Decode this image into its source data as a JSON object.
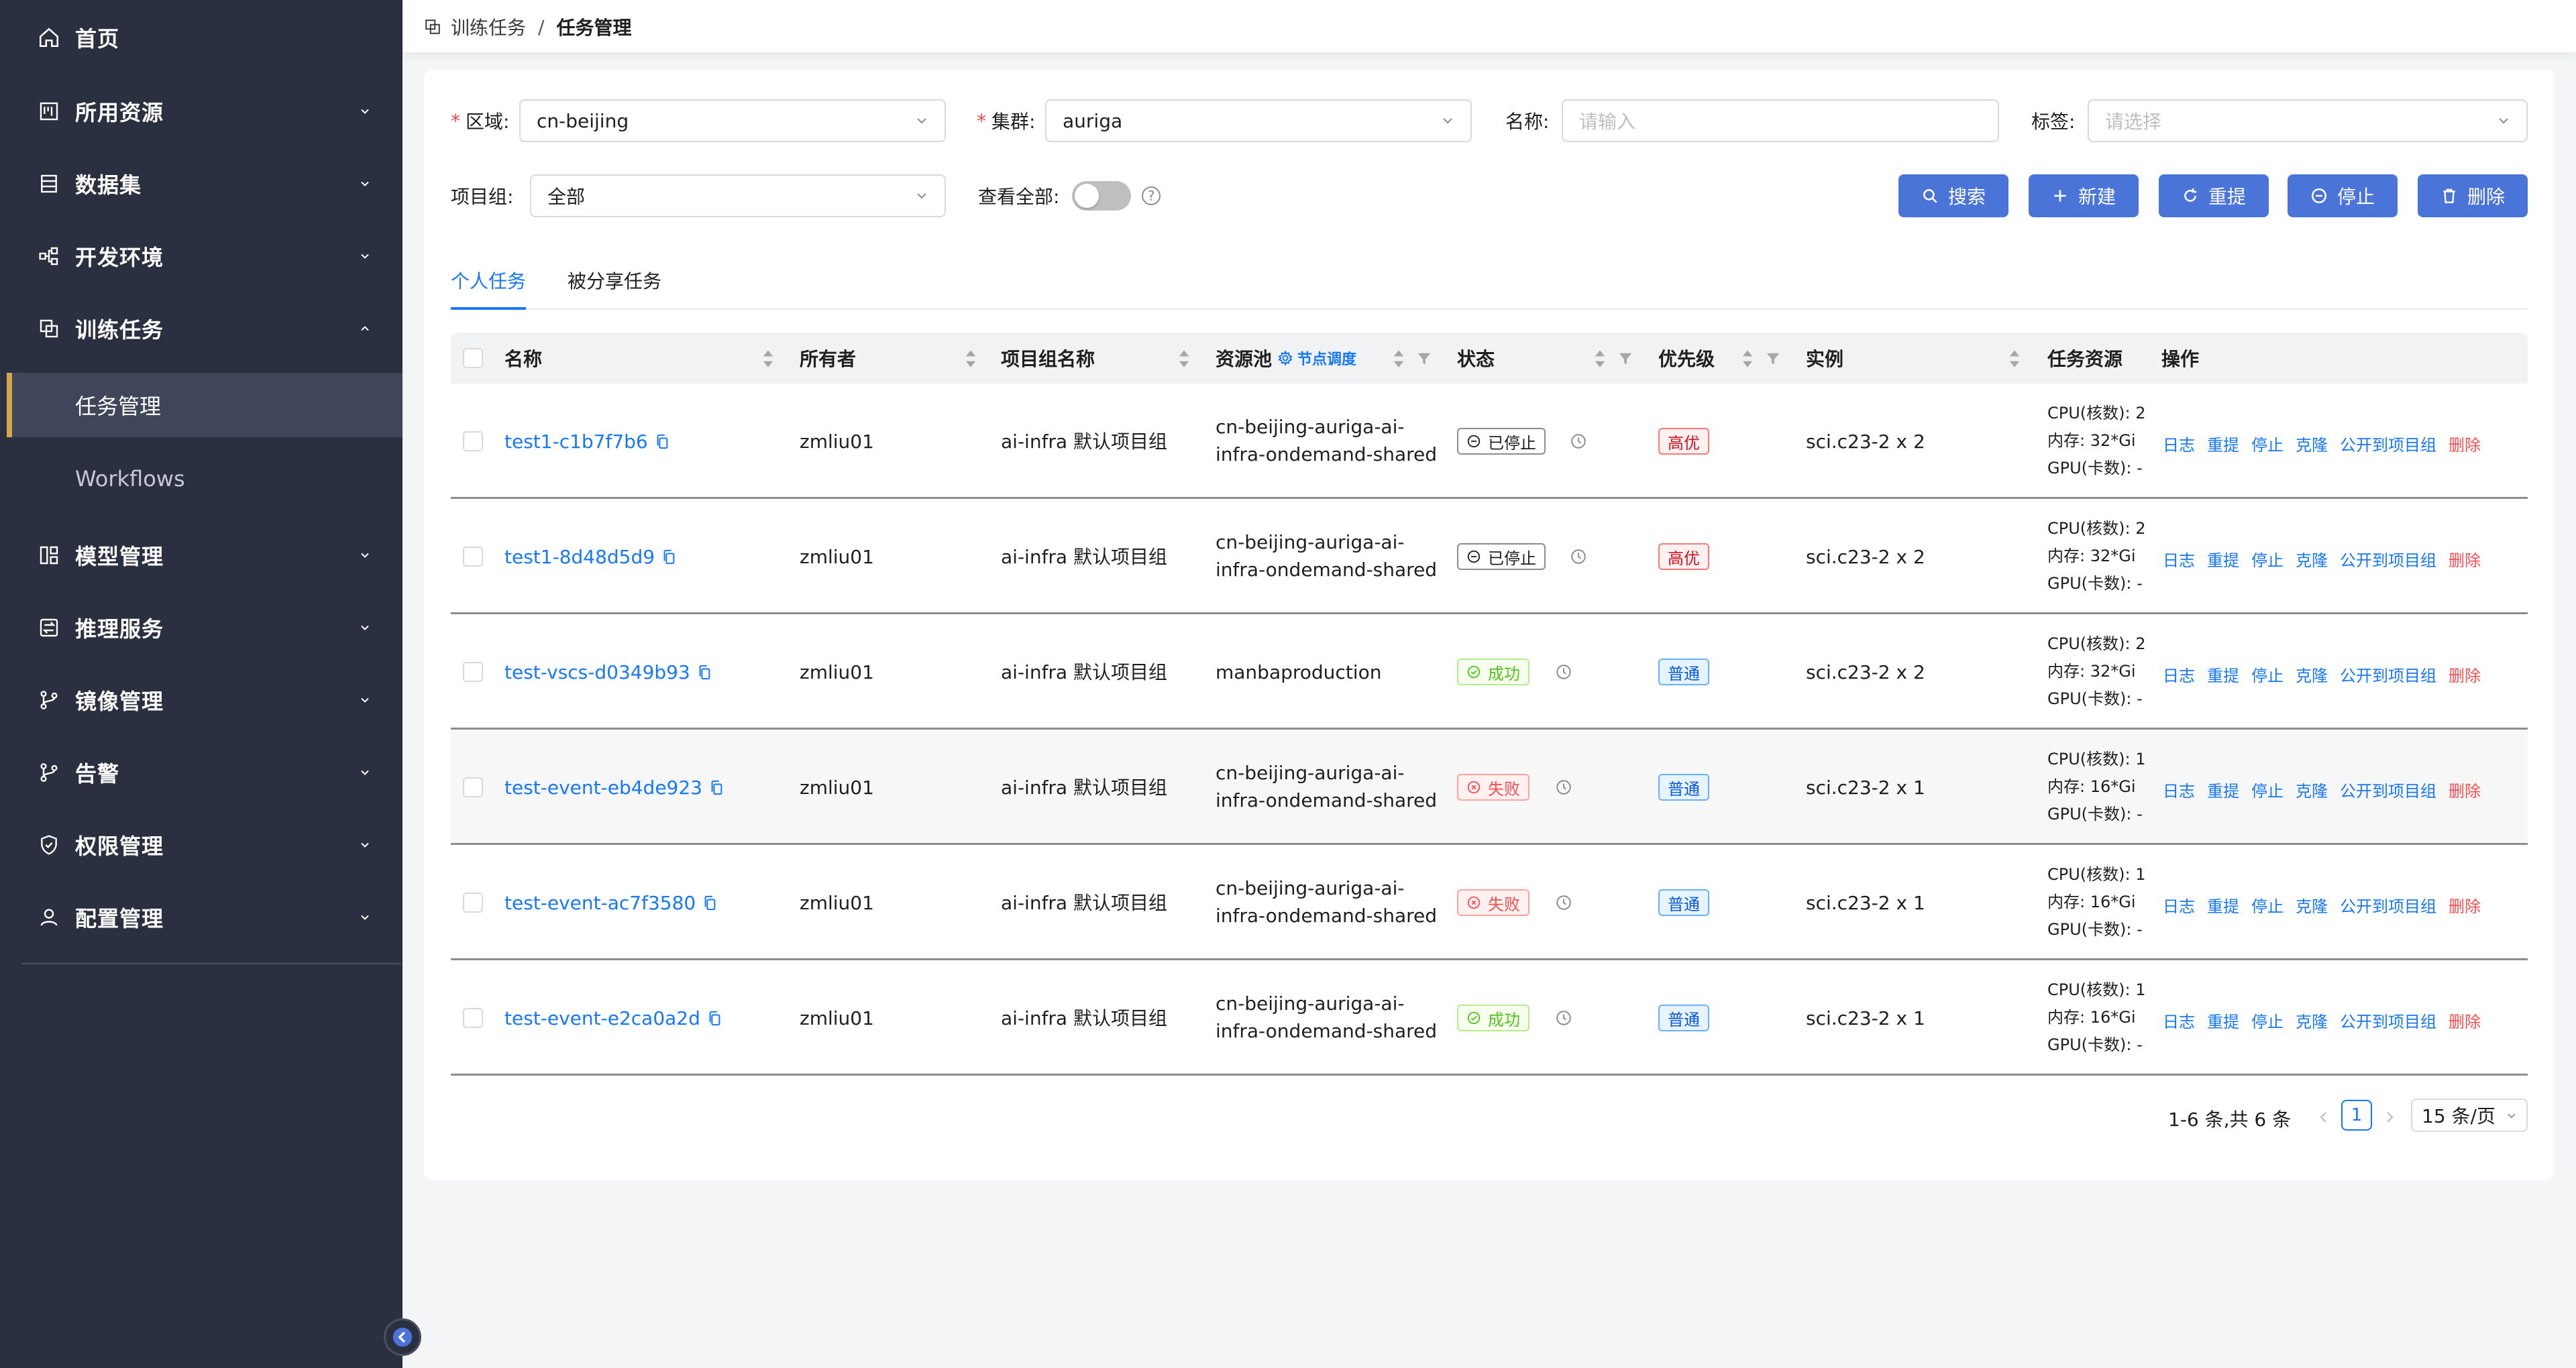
{
  "sidebar": {
    "items": [
      {
        "label": "首页",
        "icon": "home-icon"
      },
      {
        "label": "所用资源",
        "icon": "resource-icon"
      },
      {
        "label": "数据集",
        "icon": "dataset-icon"
      },
      {
        "label": "开发环境",
        "icon": "dev-env-icon"
      },
      {
        "label": "训练任务",
        "icon": "training-icon"
      },
      {
        "label": "模型管理",
        "icon": "model-icon"
      },
      {
        "label": "推理服务",
        "icon": "inference-icon"
      },
      {
        "label": "镜像管理",
        "icon": "image-branch-icon"
      },
      {
        "label": "告警",
        "icon": "alert-branch-icon"
      },
      {
        "label": "权限管理",
        "icon": "shield-icon"
      },
      {
        "label": "配置管理",
        "icon": "user-icon"
      }
    ],
    "sub_items": [
      {
        "label": "任务管理",
        "active": true
      },
      {
        "label": "Workflows",
        "active": false
      }
    ]
  },
  "breadcrumb": {
    "parent": "训练任务",
    "separator": "/",
    "current": "任务管理"
  },
  "filters": {
    "region_label": "区域:",
    "region_value": "cn-beijing",
    "cluster_label": "集群:",
    "cluster_value": "auriga",
    "name_label": "名称:",
    "name_placeholder": "请输入",
    "tag_label": "标签:",
    "tag_placeholder": "请选择",
    "project_label": "项目组:",
    "project_value": "全部",
    "view_all_label": "查看全部:",
    "view_all_on": false
  },
  "actions": {
    "search": "搜索",
    "create": "新建",
    "resubmit": "重提",
    "stop": "停止",
    "delete": "删除"
  },
  "tabs": [
    {
      "label": "个人任务",
      "active": true
    },
    {
      "label": "被分享任务",
      "active": false
    }
  ],
  "table": {
    "columns": {
      "name": "名称",
      "owner": "所有者",
      "project": "项目组名称",
      "pool": "资源池",
      "pool_link": "节点调度",
      "status": "状态",
      "priority": "优先级",
      "instance": "实例",
      "resources": "任务资源",
      "operations": "操作"
    },
    "rows": [
      {
        "name": "test1-c1b7f7b6",
        "owner": "zmliu01",
        "project": "ai-infra 默认项目组",
        "pool_line1": "cn-beijing-auriga-ai-",
        "pool_line2": "infra-ondemand-shared",
        "status": "已停止",
        "status_kind": "stopped",
        "priority": "高优",
        "priority_kind": "high",
        "instance": "sci.c23-2 x 2",
        "cpu": "CPU(核数): 2",
        "mem": "内存: 32*Gi",
        "gpu": "GPU(卡数): -"
      },
      {
        "name": "test1-8d48d5d9",
        "owner": "zmliu01",
        "project": "ai-infra 默认项目组",
        "pool_line1": "cn-beijing-auriga-ai-",
        "pool_line2": "infra-ondemand-shared",
        "status": "已停止",
        "status_kind": "stopped",
        "priority": "高优",
        "priority_kind": "high",
        "instance": "sci.c23-2 x 2",
        "cpu": "CPU(核数): 2",
        "mem": "内存: 32*Gi",
        "gpu": "GPU(卡数): -"
      },
      {
        "name": "test-vscs-d0349b93",
        "owner": "zmliu01",
        "project": "ai-infra 默认项目组",
        "pool_line1": "manbaproduction",
        "pool_line2": "",
        "status": "成功",
        "status_kind": "success",
        "priority": "普通",
        "priority_kind": "normal",
        "instance": "sci.c23-2 x 2",
        "cpu": "CPU(核数): 2",
        "mem": "内存: 32*Gi",
        "gpu": "GPU(卡数): -"
      },
      {
        "name": "test-event-eb4de923",
        "owner": "zmliu01",
        "project": "ai-infra 默认项目组",
        "pool_line1": "cn-beijing-auriga-ai-",
        "pool_line2": "infra-ondemand-shared",
        "status": "失败",
        "status_kind": "fail",
        "priority": "普通",
        "priority_kind": "normal",
        "instance": "sci.c23-2 x 1",
        "cpu": "CPU(核数): 1",
        "mem": "内存: 16*Gi",
        "gpu": "GPU(卡数): -"
      },
      {
        "name": "test-event-ac7f3580",
        "owner": "zmliu01",
        "project": "ai-infra 默认项目组",
        "pool_line1": "cn-beijing-auriga-ai-",
        "pool_line2": "infra-ondemand-shared",
        "status": "失败",
        "status_kind": "fail",
        "priority": "普通",
        "priority_kind": "normal",
        "instance": "sci.c23-2 x 1",
        "cpu": "CPU(核数): 1",
        "mem": "内存: 16*Gi",
        "gpu": "GPU(卡数): -"
      },
      {
        "name": "test-event-e2ca0a2d",
        "owner": "zmliu01",
        "project": "ai-infra 默认项目组",
        "pool_line1": "cn-beijing-auriga-ai-",
        "pool_line2": "infra-ondemand-shared",
        "status": "成功",
        "status_kind": "success",
        "priority": "普通",
        "priority_kind": "normal",
        "instance": "sci.c23-2 x 1",
        "cpu": "CPU(核数): 1",
        "mem": "内存: 16*Gi",
        "gpu": "GPU(卡数): -"
      }
    ],
    "row_ops": {
      "log": "日志",
      "resubmit": "重提",
      "stop": "停止",
      "clone": "克隆",
      "publish": "公开到项目组",
      "delete": "删除"
    }
  },
  "pagination": {
    "summary": "1-6 条,共 6 条",
    "current_page": "1",
    "page_size": "15 条/页"
  },
  "colors": {
    "sidebar_bg": "#2b3040",
    "primary": "#4a74d8",
    "link": "#1677ff",
    "danger": "#ff4d4f",
    "active_indicator": "#d2a64c"
  }
}
